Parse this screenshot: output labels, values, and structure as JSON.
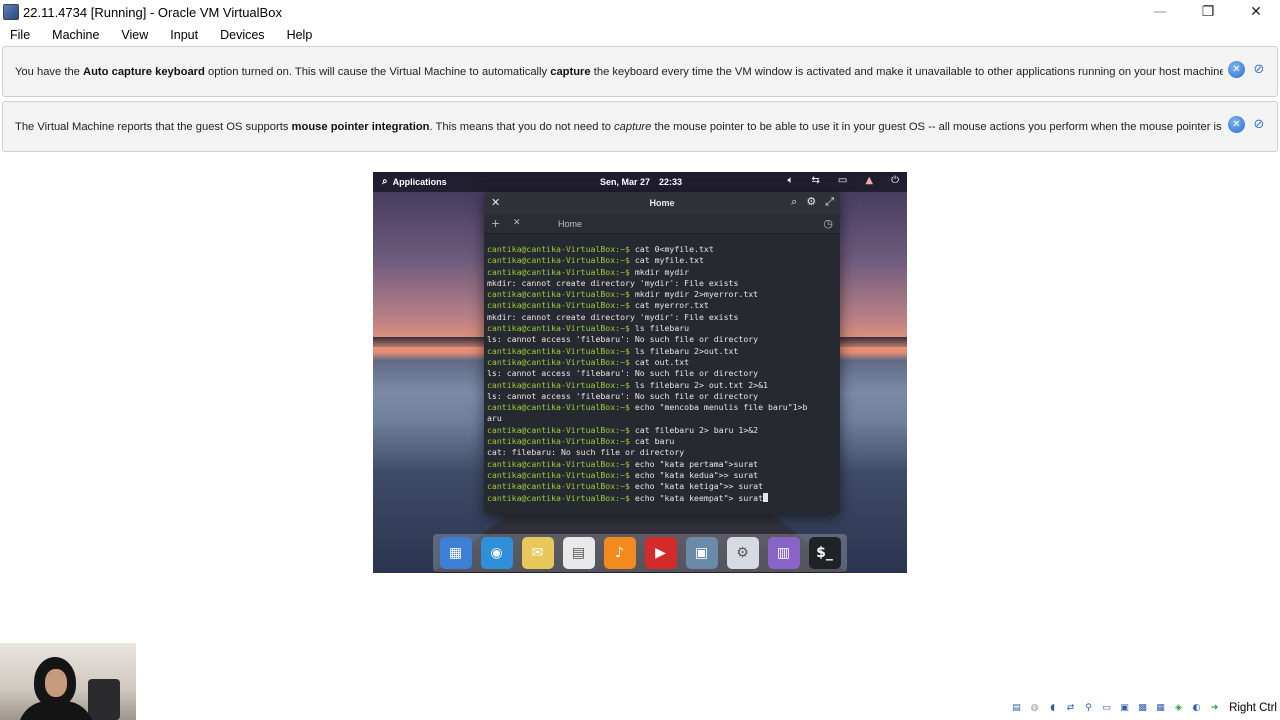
{
  "window": {
    "title": "22.11.4734 [Running] - Oracle VM VirtualBox",
    "minimize_icon": "—",
    "maximize_icon": "❐",
    "close_icon": "✕"
  },
  "menu": [
    "File",
    "Machine",
    "View",
    "Input",
    "Devices",
    "Help"
  ],
  "banners": [
    {
      "parts": [
        {
          "t": "You have the "
        },
        {
          "t": "Auto capture keyboard",
          "b": true
        },
        {
          "t": " option turned on. This will cause the Virtual Machine to automatically "
        },
        {
          "t": "capture",
          "b": true
        },
        {
          "t": " the keyboard every time the VM window is activated and make it unavailable to other applications running on your host machine: when"
        }
      ]
    },
    {
      "parts": [
        {
          "t": "The Virtual Machine reports that the guest OS supports "
        },
        {
          "t": "mouse pointer integration",
          "b": true
        },
        {
          "t": ". This means that you do not need to "
        },
        {
          "t": "capture",
          "i": true
        },
        {
          "t": " the mouse pointer to be able to use it in your guest OS -- all mouse actions you perform when the mouse pointer is over"
        }
      ]
    }
  ],
  "vm": {
    "panel": {
      "apps_label": "Applications",
      "date": "Sen, Mar 27",
      "time": "22:33"
    },
    "terminal": {
      "title": "Home",
      "tab_label": "Home",
      "lines": [
        {
          "p": "cantika@cantika-VirtualBox:~$",
          "t": " cat 0<myfile.txt"
        },
        {
          "p": "cantika@cantika-VirtualBox:~$",
          "t": " cat myfile.txt"
        },
        {
          "p": "cantika@cantika-VirtualBox:~$",
          "t": " mkdir mydir"
        },
        {
          "p": "",
          "t": "mkdir: cannot create directory 'mydir': File exists"
        },
        {
          "p": "cantika@cantika-VirtualBox:~$",
          "t": " mkdir mydir 2>myerror.txt"
        },
        {
          "p": "cantika@cantika-VirtualBox:~$",
          "t": " cat myerror.txt"
        },
        {
          "p": "",
          "t": "mkdir: cannot create directory 'mydir': File exists"
        },
        {
          "p": "cantika@cantika-VirtualBox:~$",
          "t": " ls filebaru"
        },
        {
          "p": "",
          "t": "ls: cannot access 'filebaru': No such file or directory"
        },
        {
          "p": "cantika@cantika-VirtualBox:~$",
          "t": " ls filebaru 2>out.txt"
        },
        {
          "p": "cantika@cantika-VirtualBox:~$",
          "t": " cat out.txt"
        },
        {
          "p": "",
          "t": "ls: cannot access 'filebaru': No such file or directory"
        },
        {
          "p": "cantika@cantika-VirtualBox:~$",
          "t": " ls filebaru 2> out.txt 2>&1"
        },
        {
          "p": "",
          "t": "ls: cannot access 'filebaru': No such file or directory"
        },
        {
          "p": "cantika@cantika-VirtualBox:~$",
          "t": " echo \"mencoba menulis file baru\"1>b"
        },
        {
          "p": "",
          "t": "aru"
        },
        {
          "p": "cantika@cantika-VirtualBox:~$",
          "t": " cat filebaru 2> baru 1>&2"
        },
        {
          "p": "cantika@cantika-VirtualBox:~$",
          "t": " cat baru"
        },
        {
          "p": "",
          "t": "cat: filebaru: No such file or directory"
        },
        {
          "p": "cantika@cantika-VirtualBox:~$",
          "t": " echo \"kata pertama\">surat"
        },
        {
          "p": "cantika@cantika-VirtualBox:~$",
          "t": " echo \"kata kedua\">> surat"
        },
        {
          "p": "cantika@cantika-VirtualBox:~$",
          "t": " echo \"kata ketiga\">> surat"
        },
        {
          "p": "cantika@cantika-VirtualBox:~$",
          "t": " echo \"kata keempat\"> surat",
          "cursor": true
        }
      ]
    },
    "dock": [
      {
        "name": "multitasking-view-icon",
        "bg": "#3d7fd6",
        "glyph": "▦"
      },
      {
        "name": "web-browser-icon",
        "bg": "#2f8fd9",
        "glyph": "◉"
      },
      {
        "name": "mail-icon",
        "bg": "#e8c85a",
        "glyph": "✉"
      },
      {
        "name": "calendar-icon",
        "bg": "#e9e9e9",
        "glyph": "▤"
      },
      {
        "name": "music-icon",
        "bg": "#f28a1d",
        "glyph": "♪"
      },
      {
        "name": "videos-icon",
        "bg": "#d42a2a",
        "glyph": "▶"
      },
      {
        "name": "photos-icon",
        "bg": "#6b8aa8",
        "glyph": "▣"
      },
      {
        "name": "system-settings-icon",
        "bg": "#d6dbe1",
        "glyph": "⚙"
      },
      {
        "name": "app-center-icon",
        "bg": "#8a63c8",
        "glyph": "▥"
      },
      {
        "name": "terminal-icon",
        "bg": "#1f2328",
        "glyph": "$_"
      }
    ]
  },
  "statusbar": {
    "host_key": "Right Ctrl"
  }
}
